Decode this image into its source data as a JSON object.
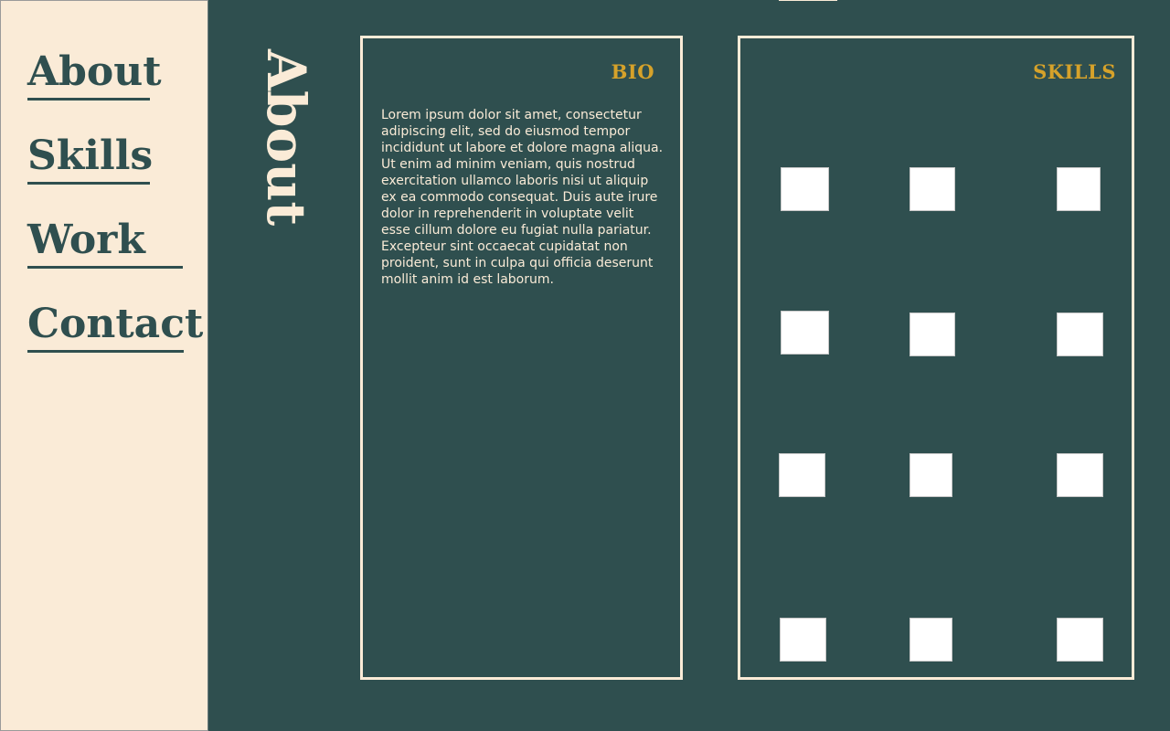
{
  "sidebar": {
    "items": [
      {
        "label": "About"
      },
      {
        "label": "Skills"
      },
      {
        "label": "Work"
      },
      {
        "label": "Contact"
      }
    ]
  },
  "main": {
    "heading": "About",
    "bio": {
      "title": "BIO",
      "text": "Lorem ipsum dolor sit amet, consectetur adipiscing elit, sed do eiusmod tempor incididunt ut labore et dolore magna aliqua. Ut enim ad minim veniam, quis nostrud exercitation ullamco laboris nisi ut aliquip ex ea commodo consequat. Duis aute irure dolor in reprehenderit in voluptate velit esse cillum dolore eu fugiat nulla pariatur. Excepteur sint occaecat cupidatat non proident, sunt in culpa qui officia deserunt mollit anim id est laborum."
    },
    "skills": {
      "title": "SKILLS",
      "icon_count": 12
    }
  },
  "colors": {
    "background": "#2f4f4f",
    "sidebar": "#faebd7",
    "accent": "#d6a22a",
    "text_light": "#faebd7"
  }
}
